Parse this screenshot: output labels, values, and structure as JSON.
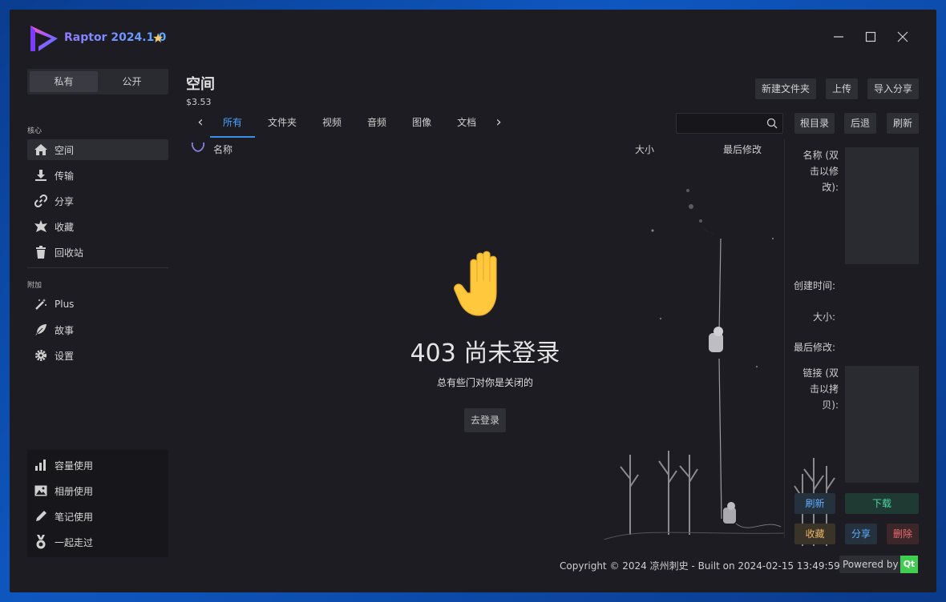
{
  "app": {
    "title": "Raptor 2024.1.0"
  },
  "sidebar": {
    "segment": [
      "私有",
      "公开"
    ],
    "core_label": "核心",
    "core_items": [
      "空间",
      "传输",
      "分享",
      "收藏",
      "回收站"
    ],
    "extra_label": "附加",
    "extra_items": [
      "Plus",
      "故事",
      "设置"
    ],
    "bottom_items": [
      "容量使用",
      "相册使用",
      "笔记使用",
      "一起走过"
    ]
  },
  "main": {
    "title": "空间",
    "balance": "$3.53",
    "top_buttons": [
      "新建文件夹",
      "上传",
      "导入分享"
    ],
    "tabs": [
      "所有",
      "文件夹",
      "视频",
      "音频",
      "图像",
      "文档"
    ],
    "search_placeholder": "",
    "nav_buttons": [
      "根目录",
      "后退",
      "刷新"
    ],
    "columns": {
      "name": "名称",
      "size": "大小",
      "modified": "最后修改"
    },
    "empty": {
      "title": "403 尚未登录",
      "subtitle": "总有些门对你是关闭的",
      "button": "去登录"
    }
  },
  "details": {
    "name_label": "名称 (双击以修改):",
    "created_label": "创建时间:",
    "size_label": "大小:",
    "modified_label": "最后修改:",
    "link_label": "链接 (双击以拷贝):",
    "actions": [
      "刷新",
      "下载",
      "收藏",
      "分享",
      "删除"
    ]
  },
  "footer": {
    "copyright": "Copyright © 2024 凉州刺史 - Built on 2024-02-15 13:49:59",
    "powered_by": "Powered by",
    "qt": "Qt"
  },
  "colors": {
    "accent": "#3b8fe8",
    "window_bg": "#1c1c22",
    "panel_bg": "#2a2a31"
  }
}
